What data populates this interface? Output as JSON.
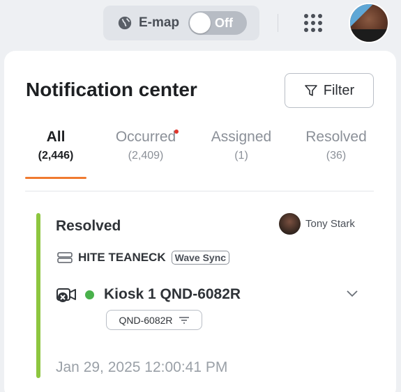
{
  "topbar": {
    "emap_label": "E-map",
    "emap_toggle_state": "Off",
    "globe_icon": "globe-icon",
    "apps_icon": "apps-grid-icon",
    "avatar_icon": "user-avatar"
  },
  "panel": {
    "title": "Notification center",
    "filter_label": "Filter",
    "tabs": [
      {
        "label": "All",
        "count": "(2,446)",
        "active": true
      },
      {
        "label": "Occurred",
        "count": "(2,409)",
        "active": false,
        "has_dot": true
      },
      {
        "label": "Assigned",
        "count": "(1)",
        "active": false
      },
      {
        "label": "Resolved",
        "count": "(36)",
        "active": false
      }
    ]
  },
  "card": {
    "status": "Resolved",
    "assignee": "Tony Stark",
    "site_name": "HITE TEANECK",
    "site_tag": "Wave Sync",
    "device_name": "Kiosk 1 QND-6082R",
    "device_status_color": "#49b14b",
    "model_chip": "QND-6082R",
    "timestamp": "Jan 29, 2025 12:00:41 PM",
    "accent_color": "#8dc63f"
  },
  "colors": {
    "active_tab_underline": "#f07a30",
    "notification_dot": "#e0352b"
  }
}
